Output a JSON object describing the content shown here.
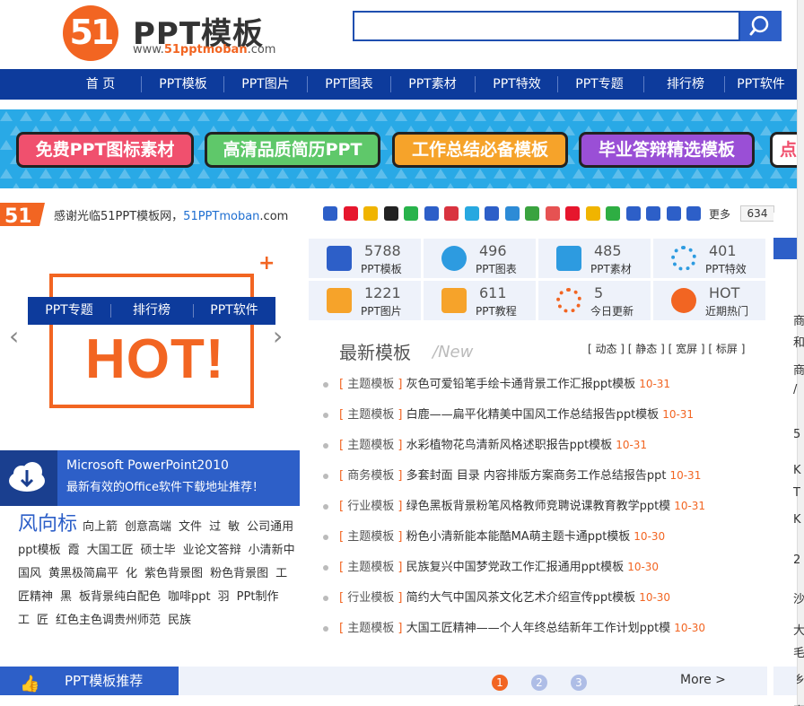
{
  "header": {
    "logo_mark": "51",
    "logo_title": "PPT模板",
    "logo_url_prefix": "www.",
    "logo_url_mid": "51pptmoban",
    "logo_url_suffix": ".com",
    "search_placeholder": ""
  },
  "nav": [
    "首 页",
    "PPT模板",
    "PPT图片",
    "PPT图表",
    "PPT素材",
    "PPT特效",
    "PPT专题",
    "排行榜",
    "PPT软件"
  ],
  "banner": {
    "buttons": [
      {
        "label": "免费PPT图标素材",
        "color": "#f0506e"
      },
      {
        "label": "高清品质简历PPT",
        "color": "#5fc86a"
      },
      {
        "label": "工作总结必备模板",
        "color": "#f6a32a"
      },
      {
        "label": "毕业答辩精选模板",
        "color": "#9a4fd6"
      },
      {
        "label": "点击",
        "color": "#ffffff"
      }
    ]
  },
  "share": {
    "welcome": "感谢光临51PPT模板网，",
    "site": "51PPTmoban",
    "site_suffix": ".com",
    "more": "更多",
    "count": "634"
  },
  "left": {
    "tabs": [
      "PPT专题",
      "排行榜",
      "PPT软件"
    ],
    "hot": "HOT!",
    "plus": "+",
    "office_line1": "Microsoft PowerPoint2010",
    "office_line2": "最新有效的Office软件下载地址推荐！",
    "wind_title": "风向标",
    "wind_words": [
      "向上箭",
      "创意高端",
      "文件",
      "过",
      "敏",
      "公司通用ppt模板",
      "霞",
      "大国工匠",
      "硕士毕",
      "业论文答辩",
      "小清新中国风",
      "黄黑极简扁平",
      "化",
      "紫色背景图",
      "粉色背景图",
      "工匠精神",
      "黑",
      "板背景纯白配色",
      "咖啡ppt",
      "羽",
      "PPt制作",
      "工",
      "匠",
      "红色主色调贵州师范",
      "民族"
    ]
  },
  "stats": [
    {
      "num": "5788",
      "label": "PPT模板",
      "icon": "ppt-doc-icon"
    },
    {
      "num": "496",
      "label": "PPT图表",
      "icon": "pie-chart-icon"
    },
    {
      "num": "485",
      "label": "PPT素材",
      "icon": "tools-icon"
    },
    {
      "num": "401",
      "label": "PPT特效",
      "icon": "spinner-icon"
    },
    {
      "num": "1221",
      "label": "PPT图片",
      "icon": "image-icon"
    },
    {
      "num": "611",
      "label": "PPT教程",
      "icon": "book-icon"
    },
    {
      "num": "5",
      "label": "今日更新",
      "icon": "refresh-icon"
    },
    {
      "num": "HOT",
      "label": "近期热门",
      "icon": "hot-icon"
    }
  ],
  "latest": {
    "title": "最新模板",
    "subtitle": "/New",
    "filters": "[ 动态 ] [ 静态 ] [ 宽屏 ] [ 标屏 ]",
    "items": [
      {
        "cat": "主题模板",
        "title": "灰色可爱铅笔手绘卡通背景工作汇报ppt模板",
        "date": "10-31"
      },
      {
        "cat": "主题模板",
        "title": "白鹿——扁平化精美中国风工作总结报告ppt模板",
        "date": "10-31"
      },
      {
        "cat": "主题模板",
        "title": "水彩植物花鸟清新风格述职报告ppt模板",
        "date": "10-31"
      },
      {
        "cat": "商务模板",
        "title": "多套封面 目录 内容排版方案商务工作总结报告ppt",
        "date": "10-31"
      },
      {
        "cat": "行业模板",
        "title": "绿色黑板背景粉笔风格教师竞聘说课教育教学ppt模",
        "date": "10-31"
      },
      {
        "cat": "主题模板",
        "title": "粉色小清新能本能酷MA萌主题卡通ppt模板",
        "date": "10-30"
      },
      {
        "cat": "主题模板",
        "title": "民族复兴中国梦党政工作汇报通用ppt模板",
        "date": "10-30"
      },
      {
        "cat": "行业模板",
        "title": "简约大气中国风茶文化艺术介绍宣传ppt模板",
        "date": "10-30"
      },
      {
        "cat": "主题模板",
        "title": "大国工匠精神——个人年终总结新年工作计划ppt模",
        "date": "10-30"
      }
    ]
  },
  "right_sliver": [
    "商",
    "和",
    "商",
    "/",
    "5",
    "K",
    "T",
    "K",
    "2",
    "沙",
    "大",
    "毛",
    "乡",
    "妻"
  ],
  "bottom": {
    "title": "PPT模板推荐",
    "pages": [
      "1",
      "2",
      "3"
    ],
    "more": "More >"
  }
}
